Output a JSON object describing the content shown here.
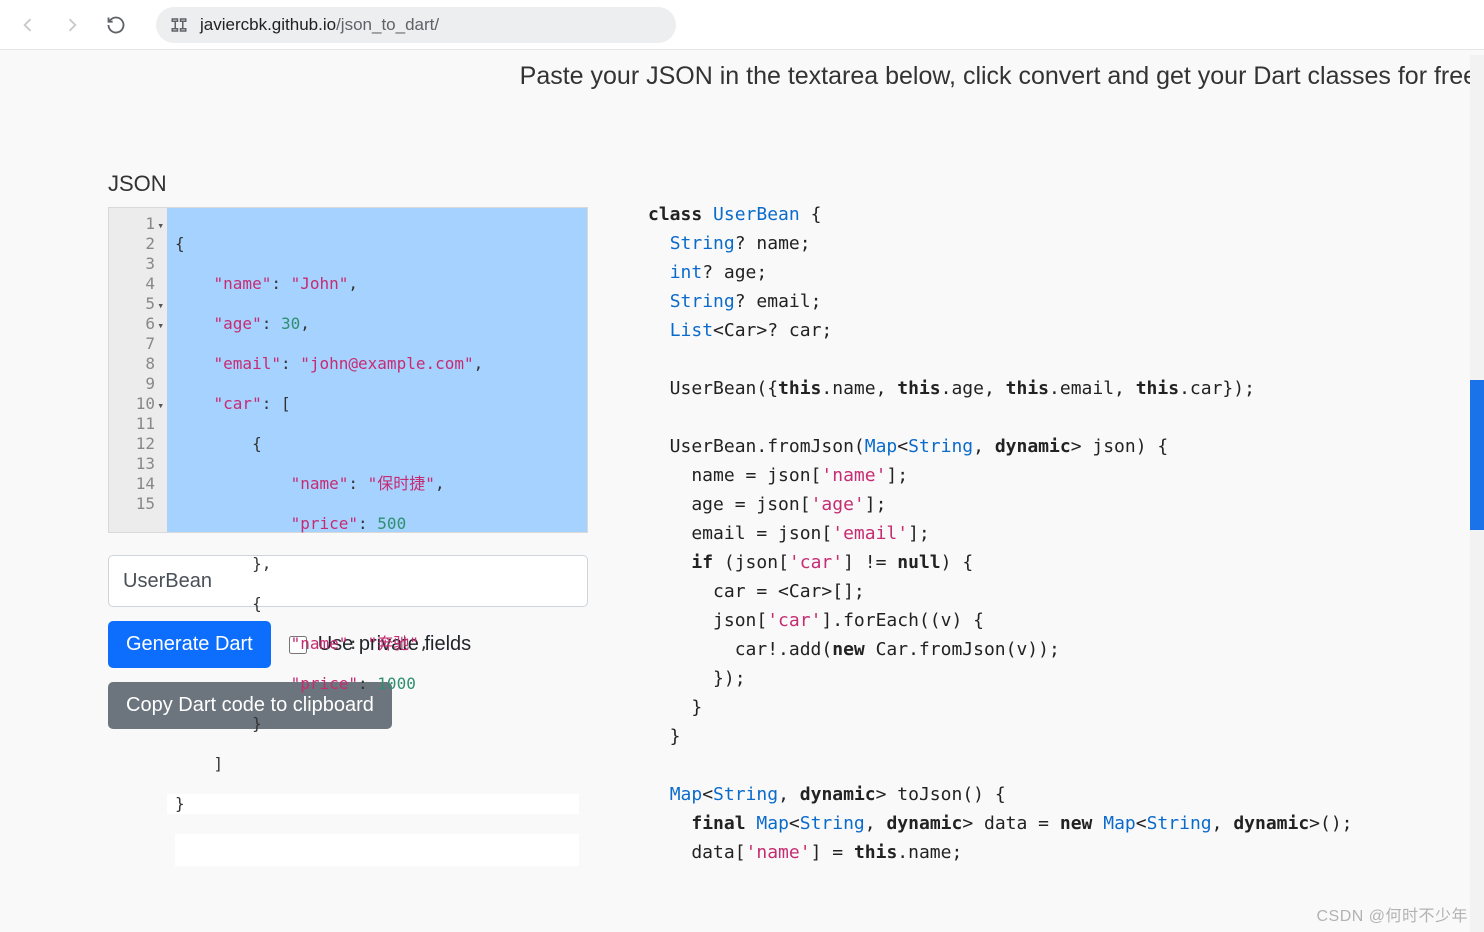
{
  "browser": {
    "url_host": "javiercbk.github.io",
    "url_path": "/json_to_dart/"
  },
  "tagline": "Paste your JSON in the textarea below, click convert and get your Dart classes for free.",
  "left": {
    "section_label": "JSON",
    "classname_value": "UserBean",
    "generate_label": "Generate Dart",
    "private_label": "Use private fields",
    "copy_label": "Copy Dart code to clipboard",
    "json_lines": {
      "l1": "{",
      "l2a": "\"name\"",
      "l2b": ": ",
      "l2c": "\"John\"",
      "l2d": ",",
      "l3a": "\"age\"",
      "l3b": ": ",
      "l3c": "30",
      "l3d": ",",
      "l4a": "\"email\"",
      "l4b": ": ",
      "l4c": "\"john@example.com\"",
      "l4d": ",",
      "l5a": "\"car\"",
      "l5b": ": [",
      "l6": "{",
      "l7a": "\"name\"",
      "l7b": ": ",
      "l7c": "\"保时捷\"",
      "l7d": ",",
      "l8a": "\"price\"",
      "l8b": ": ",
      "l8c": "500",
      "l9": "},",
      "l10": "{",
      "l11a": "\"name\"",
      "l11b": ": ",
      "l11c": "\"奔驰\"",
      "l11d": ",",
      "l12a": "\"price\"",
      "l12b": ": ",
      "l12c": "1000",
      "l13": "}",
      "l14": "]",
      "l15": "}"
    },
    "line_numbers": [
      "1",
      "2",
      "3",
      "4",
      "5",
      "6",
      "7",
      "8",
      "9",
      "10",
      "11",
      "12",
      "13",
      "14",
      "15"
    ]
  },
  "dart": {
    "l1a": "class ",
    "l1b": "UserBean",
    "l1c": " {",
    "l2a": "String",
    "l2b": "? name;",
    "l3a": "int",
    "l3b": "? age;",
    "l4a": "String",
    "l4b": "? email;",
    "l5a": "List",
    "l5b": "<Car>? car;",
    "l6": "",
    "l7a": "  UserBean({",
    "l7b": "this",
    "l7c": ".name, ",
    "l7d": "this",
    "l7e": ".age, ",
    "l7f": "this",
    "l7g": ".email, ",
    "l7h": "this",
    "l7i": ".car});",
    "l8": "",
    "l9a": "  UserBean.fromJson(",
    "l9b": "Map",
    "l9c": "<",
    "l9d": "String",
    "l9e": ", ",
    "l9f": "dynamic",
    "l9g": "> json) {",
    "l10a": "    name = json[",
    "l10b": "'name'",
    "l10c": "];",
    "l11a": "    age = json[",
    "l11b": "'age'",
    "l11c": "];",
    "l12a": "    email = json[",
    "l12b": "'email'",
    "l12c": "];",
    "l13a": "    ",
    "l13b": "if",
    "l13c": " (json[",
    "l13d": "'car'",
    "l13e": "] != ",
    "l13f": "null",
    "l13g": ") {",
    "l14": "      car = <Car>[];",
    "l15a": "      json[",
    "l15b": "'car'",
    "l15c": "].forEach((v) {",
    "l16a": "        car!.add(",
    "l16b": "new",
    "l16c": " Car.fromJson(v));",
    "l17": "      });",
    "l18": "    }",
    "l19": "  }",
    "l20": "",
    "l21a": "  ",
    "l21b": "Map",
    "l21c": "<",
    "l21d": "String",
    "l21e": ", ",
    "l21f": "dynamic",
    "l21g": "> toJson() {",
    "l22a": "    ",
    "l22b": "final ",
    "l22c": "Map",
    "l22d": "<",
    "l22e": "String",
    "l22f": ", ",
    "l22g": "dynamic",
    "l22h": "> data = ",
    "l22i": "new ",
    "l22j": "Map",
    "l22k": "<",
    "l22l": "String",
    "l22m": ", ",
    "l22n": "dynamic",
    "l22o": ">();",
    "l23a": "    data[",
    "l23b": "'name'",
    "l23c": "] = ",
    "l23d": "this",
    "l23e": ".name;"
  },
  "watermark": "CSDN @何时不少年"
}
